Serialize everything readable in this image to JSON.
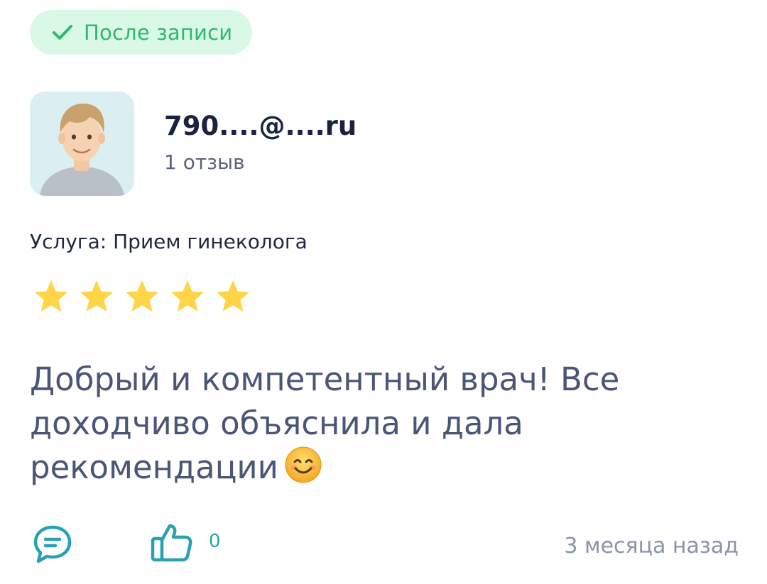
{
  "badge": {
    "label": "После записи",
    "icon": "check-icon",
    "color": "#2fb96b",
    "background": "#d9f8e6"
  },
  "author": {
    "name": "790....@....ru",
    "review_count": "1 отзыв",
    "avatar": "user-avatar-illustration"
  },
  "service": "Услуга: Прием гинеколога",
  "rating": {
    "value": 5,
    "max": 5,
    "color": "#ffd447"
  },
  "review": {
    "text": "Добрый и компетентный врач! Все доходчиво объяснила и дала рекомендации",
    "emoji": "smiling-face-emoji"
  },
  "actions": {
    "comment_icon": "comment-icon",
    "like_icon": "thumbs-up-icon",
    "like_count": "0",
    "accent_color": "#2aa0b5"
  },
  "time_ago": "3 месяца назад"
}
